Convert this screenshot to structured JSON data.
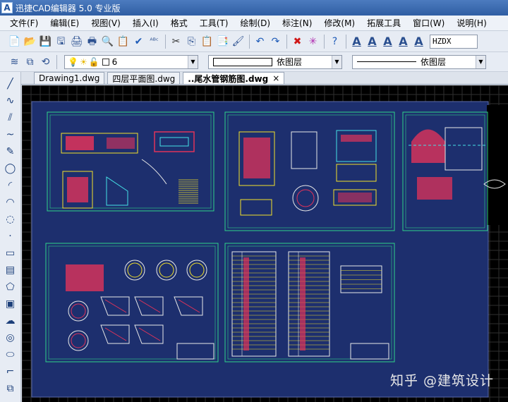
{
  "app": {
    "icon_letter": "A",
    "title": "迅捷CAD编辑器 5.0 专业版"
  },
  "menu": [
    "文件(F)",
    "编辑(E)",
    "视图(V)",
    "插入(I)",
    "格式",
    "工具(T)",
    "绘制(D)",
    "标注(N)",
    "修改(M)",
    "拓展工具",
    "窗口(W)",
    "说明(H)"
  ],
  "toolbar": {
    "buttons": [
      {
        "name": "new-icon",
        "glyph": "📄"
      },
      {
        "name": "open-icon",
        "glyph": "📂"
      },
      {
        "name": "save-icon",
        "glyph": "💾"
      },
      {
        "name": "save-all-icon",
        "glyph": "🖫"
      },
      {
        "name": "print-icon",
        "glyph": "🖨"
      },
      {
        "name": "print-preview-icon",
        "glyph": "🖶"
      },
      {
        "name": "zoom-preview-icon",
        "glyph": "🔍"
      },
      {
        "name": "copy-doc-icon",
        "glyph": "📋"
      },
      {
        "name": "check-icon",
        "glyph": "✔"
      },
      {
        "name": "spellcheck-icon",
        "glyph": "ᴬᴮᶜ"
      },
      {
        "name": "sep"
      },
      {
        "name": "cut-icon",
        "glyph": "✂"
      },
      {
        "name": "copy-icon",
        "glyph": "⎘"
      },
      {
        "name": "paste-icon",
        "glyph": "📋"
      },
      {
        "name": "paste-special-icon",
        "glyph": "📑"
      },
      {
        "name": "match-properties-icon",
        "glyph": "🖌"
      },
      {
        "name": "sep"
      },
      {
        "name": "undo-icon",
        "glyph": "↶"
      },
      {
        "name": "redo-icon",
        "glyph": "↷"
      },
      {
        "name": "sep"
      },
      {
        "name": "delete-icon",
        "glyph": "✖"
      },
      {
        "name": "explode-icon",
        "glyph": "✳"
      },
      {
        "name": "sep"
      },
      {
        "name": "help-icon",
        "glyph": "?"
      },
      {
        "name": "sep"
      },
      {
        "name": "text-a-icon",
        "glyph": "A"
      },
      {
        "name": "text-edit-icon",
        "glyph": "A"
      },
      {
        "name": "text-style-icon",
        "glyph": "A"
      },
      {
        "name": "text-find-icon",
        "glyph": "A"
      },
      {
        "name": "text-format-icon",
        "glyph": "A"
      }
    ],
    "font_name": "HZDX"
  },
  "layer_bar": {
    "layer_value": "6",
    "color_value": "依图层",
    "linetype_value": "依图层"
  },
  "left_tools": [
    {
      "name": "line-tool-icon",
      "glyph": "╱"
    },
    {
      "name": "polyline-tool-icon",
      "glyph": "∿"
    },
    {
      "name": "double-line-tool-icon",
      "glyph": "⫽"
    },
    {
      "name": "spline-tool-icon",
      "glyph": "~"
    },
    {
      "name": "freehand-tool-icon",
      "glyph": "✎"
    },
    {
      "name": "circle-tool-icon",
      "glyph": "◯"
    },
    {
      "name": "arc-tool-icon",
      "glyph": "◜"
    },
    {
      "name": "arc2-tool-icon",
      "glyph": "◠"
    },
    {
      "name": "ellipse-arc-tool-icon",
      "glyph": "◌"
    },
    {
      "name": "point-tool-icon",
      "glyph": "·"
    },
    {
      "name": "rectangle-tool-icon",
      "glyph": "▭"
    },
    {
      "name": "hatch-tool-icon",
      "glyph": "▤"
    },
    {
      "name": "polygon-tool-icon",
      "glyph": "⬠"
    },
    {
      "name": "region-tool-icon",
      "glyph": "▣"
    },
    {
      "name": "cloud-tool-icon",
      "glyph": "☁"
    },
    {
      "name": "donut-tool-icon",
      "glyph": "◎"
    },
    {
      "name": "ellipse-tool-icon",
      "glyph": "⬭"
    },
    {
      "name": "fillet-tool-icon",
      "glyph": "⌐"
    },
    {
      "name": "block-tool-icon",
      "glyph": "⧉"
    }
  ],
  "tabs": [
    {
      "label": "Drawing1.dwg",
      "active": false
    },
    {
      "label": "四层平面图.dwg",
      "active": false
    },
    {
      "label": "..尾水管钢筋图.dwg",
      "active": true,
      "close": "×"
    }
  ],
  "watermark": "知乎 @建筑设计",
  "colors": {
    "canvas_bg": "#000000",
    "sheet_bg": "#1d2f6e",
    "grid": "#2f2f2f",
    "frame": "#2fd38a",
    "drawing_red": "#e0335a",
    "drawing_yellow": "#f2e02a",
    "drawing_cyan": "#45e0e6",
    "drawing_white": "#e8e8e8"
  }
}
